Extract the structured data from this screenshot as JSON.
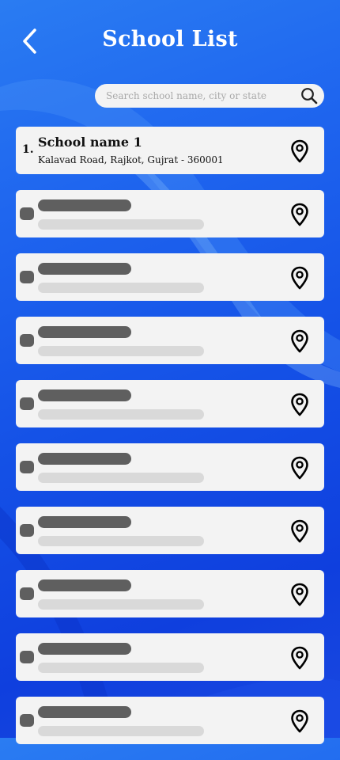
{
  "header": {
    "title": "School List",
    "back_icon": "chevron-left-icon"
  },
  "search": {
    "placeholder": "Search school name, city or state",
    "icon": "search-icon"
  },
  "schools": [
    {
      "number": "1.",
      "name": "School name 1",
      "address": "Kalavad Road, Rajkot, Gujrat - 360001",
      "loaded": true
    },
    {
      "loaded": false
    },
    {
      "loaded": false
    },
    {
      "loaded": false
    },
    {
      "loaded": false
    },
    {
      "loaded": false
    },
    {
      "loaded": false
    },
    {
      "loaded": false
    },
    {
      "loaded": false
    },
    {
      "loaded": false
    }
  ],
  "colors": {
    "background_top": "#2a7cf2",
    "background_bottom": "#0f3fde",
    "card": "#f3f3f3",
    "skeleton_dark": "#5f5f5f",
    "skeleton_light": "#d9d9d9"
  }
}
